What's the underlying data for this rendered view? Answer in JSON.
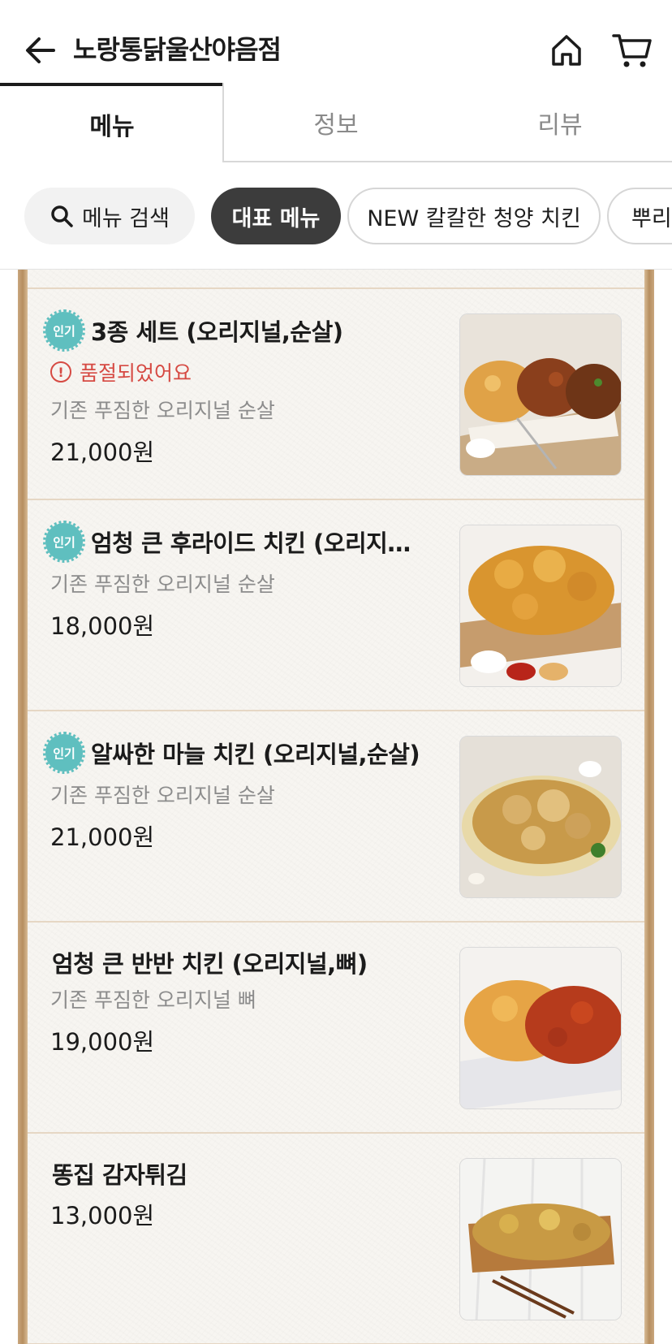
{
  "header": {
    "store_name": "노랑통닭울산야음점"
  },
  "tabs": [
    {
      "label": "메뉴",
      "active": true
    },
    {
      "label": "정보",
      "active": false
    },
    {
      "label": "리뷰",
      "active": false
    }
  ],
  "chips": {
    "search_label": "메뉴 검색",
    "items": [
      "대표 메뉴",
      "NEW 칼칼한 청양 치킨",
      "뿌리..."
    ]
  },
  "badge_label": "인기",
  "menu_items": [
    {
      "name": "3종 세트 (오리지널,순살)",
      "popular": true,
      "sold_out_text": "품절되었어요",
      "desc": "기존 푸짐한 오리지널 순살",
      "price": "21,000원",
      "image": "chicken-set-photo"
    },
    {
      "name": "엄청 큰 후라이드 치킨 (오리지…",
      "popular": true,
      "desc": "기존 푸짐한 오리지널 순살",
      "price": "18,000원",
      "image": "fried-chicken-photo"
    },
    {
      "name": "알싸한 마늘 치킨 (오리지널,순살)",
      "popular": true,
      "desc": "기존 푸짐한 오리지널 순살",
      "price": "21,000원",
      "image": "garlic-chicken-photo"
    },
    {
      "name": "엄청 큰 반반 치킨 (오리지널,뼈)",
      "popular": false,
      "desc": "기존 푸짐한 오리지널 뼈",
      "price": "19,000원",
      "image": "half-half-chicken-photo"
    },
    {
      "name": "똥집 감자튀김",
      "popular": false,
      "price": "13,000원",
      "image": "gizzard-fries-photo"
    }
  ],
  "colors": {
    "accent_badge": "#5fbfbf",
    "sold_out": "#d64a43",
    "active_chip": "#3c3c3c",
    "frame": "#b68e5f"
  }
}
